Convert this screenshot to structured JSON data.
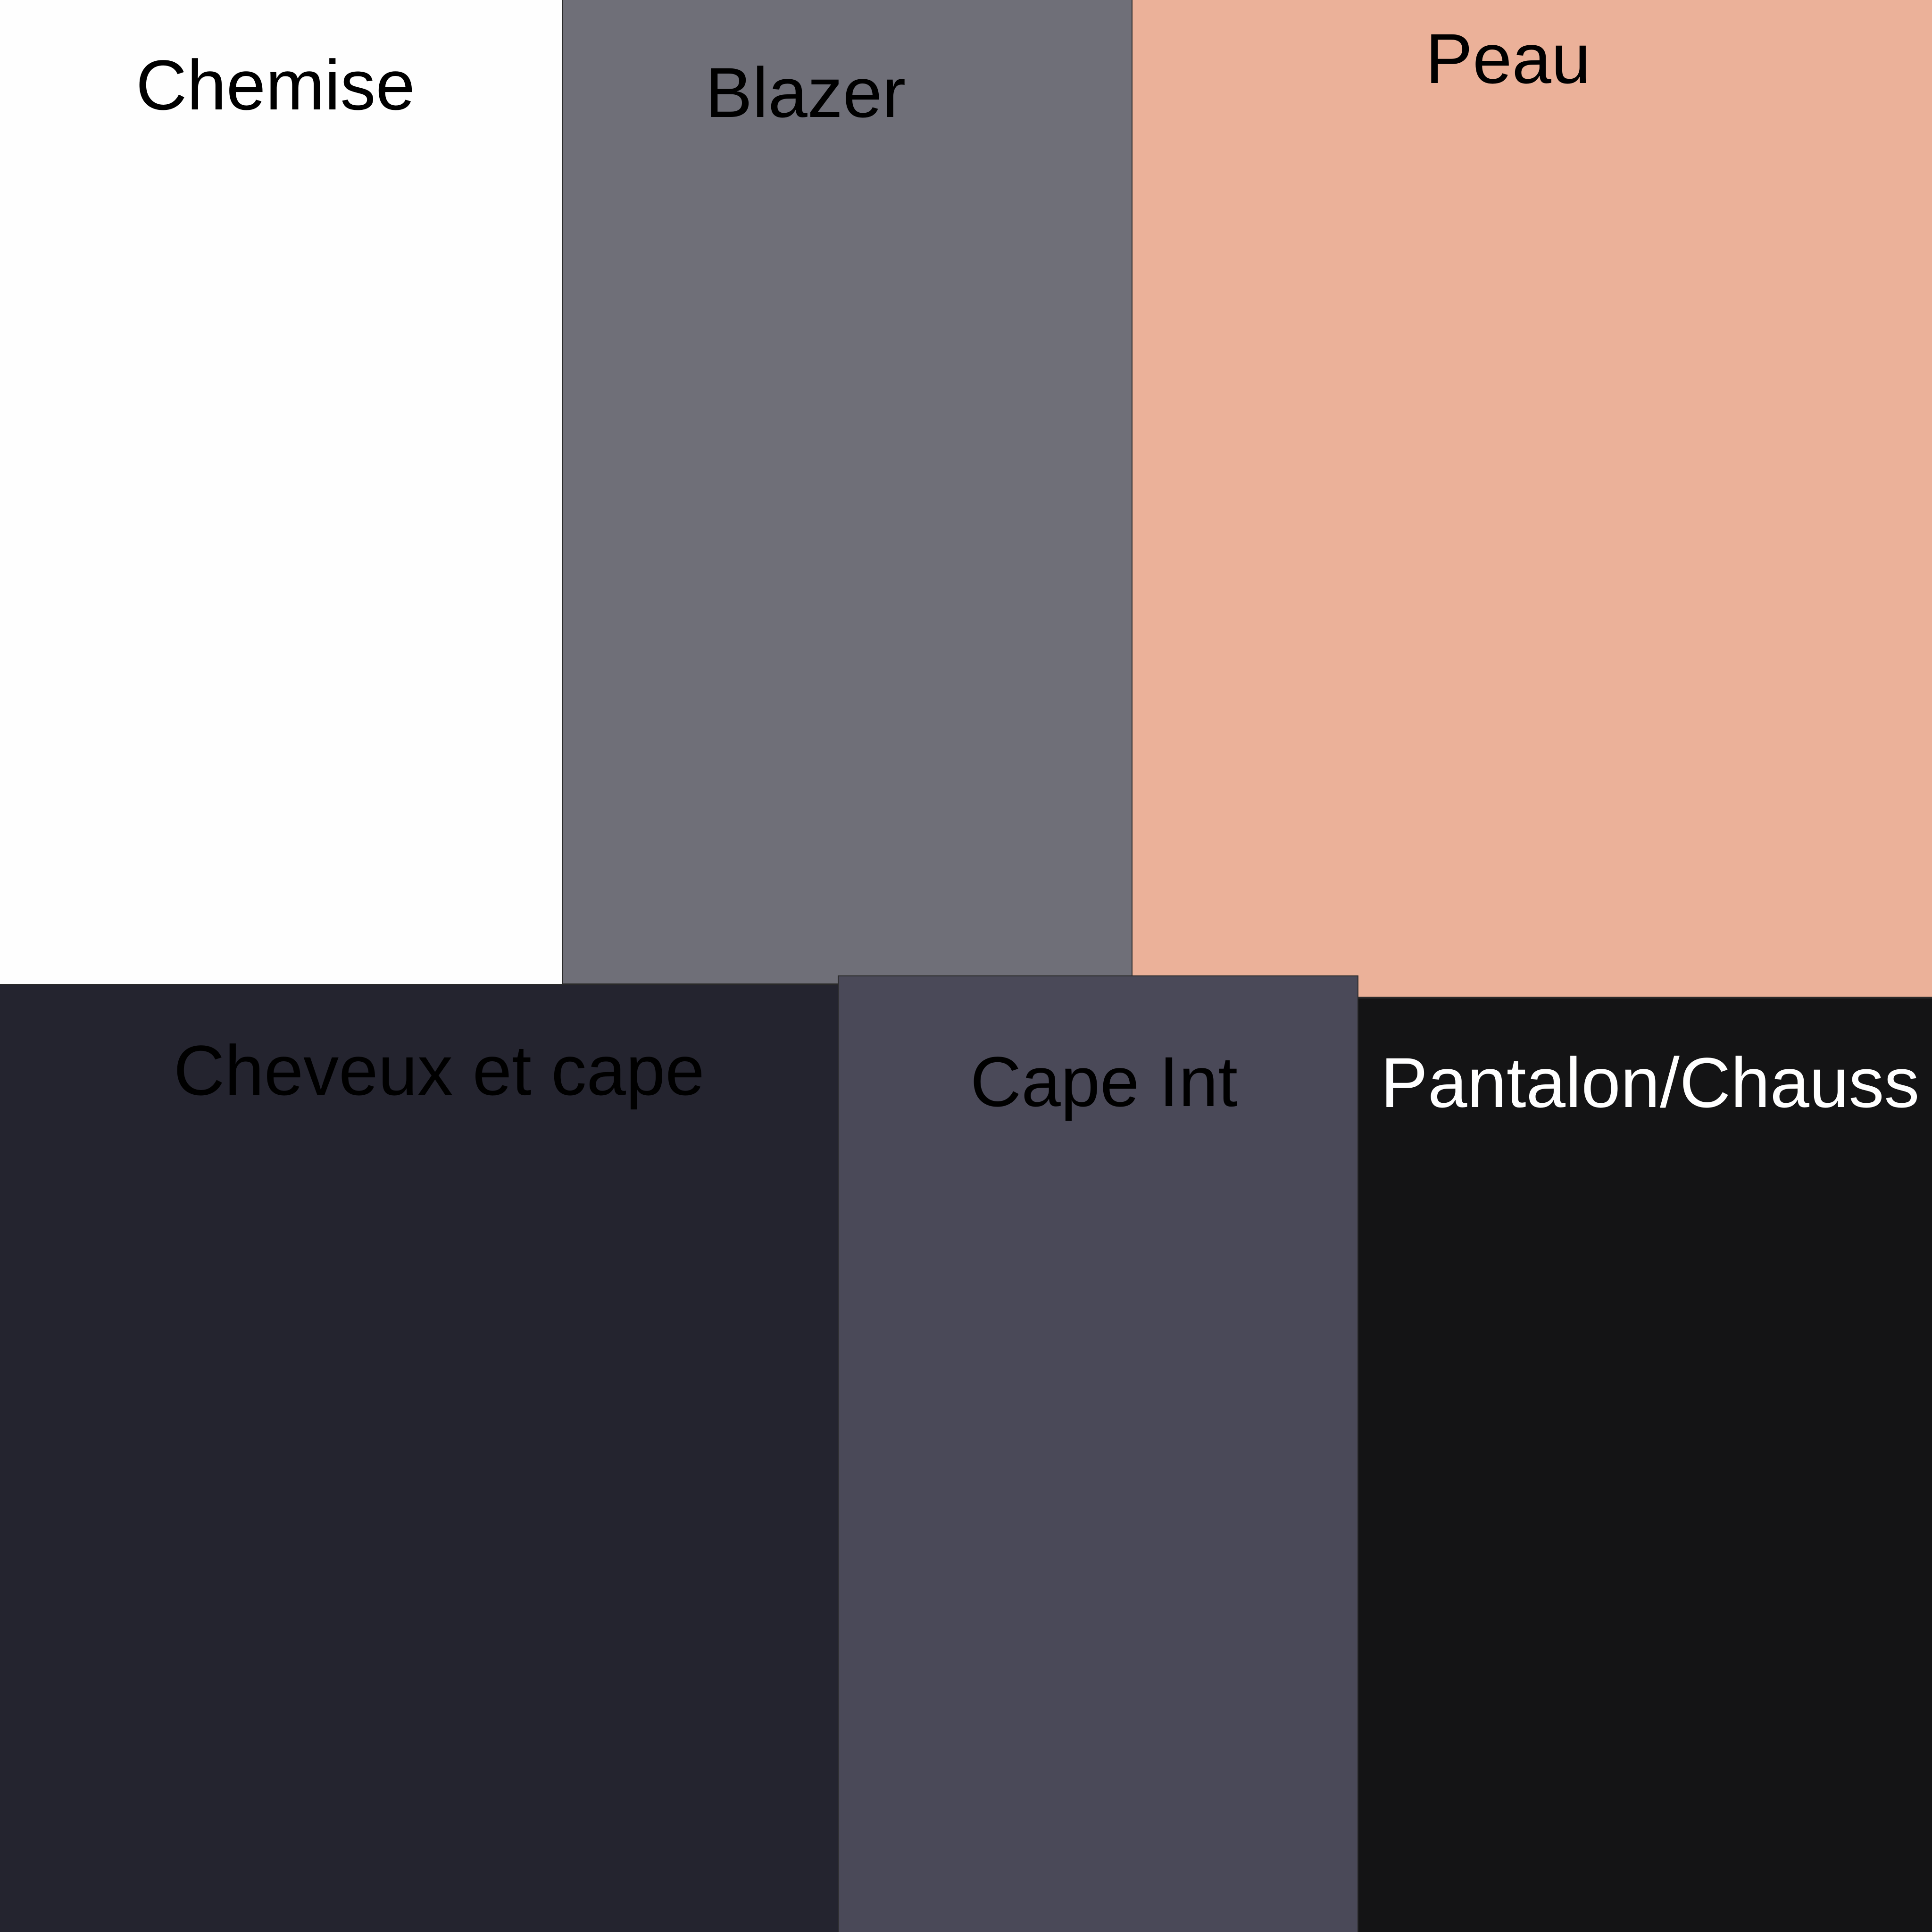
{
  "swatches": [
    {
      "id": "chemise",
      "label": "Chemise",
      "color": "#fefefe",
      "text_color": "#000000"
    },
    {
      "id": "blazer",
      "label": "Blazer",
      "color": "#6f6f78",
      "text_color": "#000000"
    },
    {
      "id": "peau",
      "label": "Peau",
      "color": "#ebb199",
      "text_color": "#000000"
    },
    {
      "id": "cheveux",
      "label": "Cheveux et cape",
      "color": "#24242f",
      "text_color": "#000000"
    },
    {
      "id": "capeint",
      "label": "Cape Int",
      "color": "#4a4958",
      "text_color": "#000000"
    },
    {
      "id": "pantalon",
      "label": "Pantalon/Chauss",
      "color": "#141415",
      "text_color": "#ffffff"
    }
  ]
}
